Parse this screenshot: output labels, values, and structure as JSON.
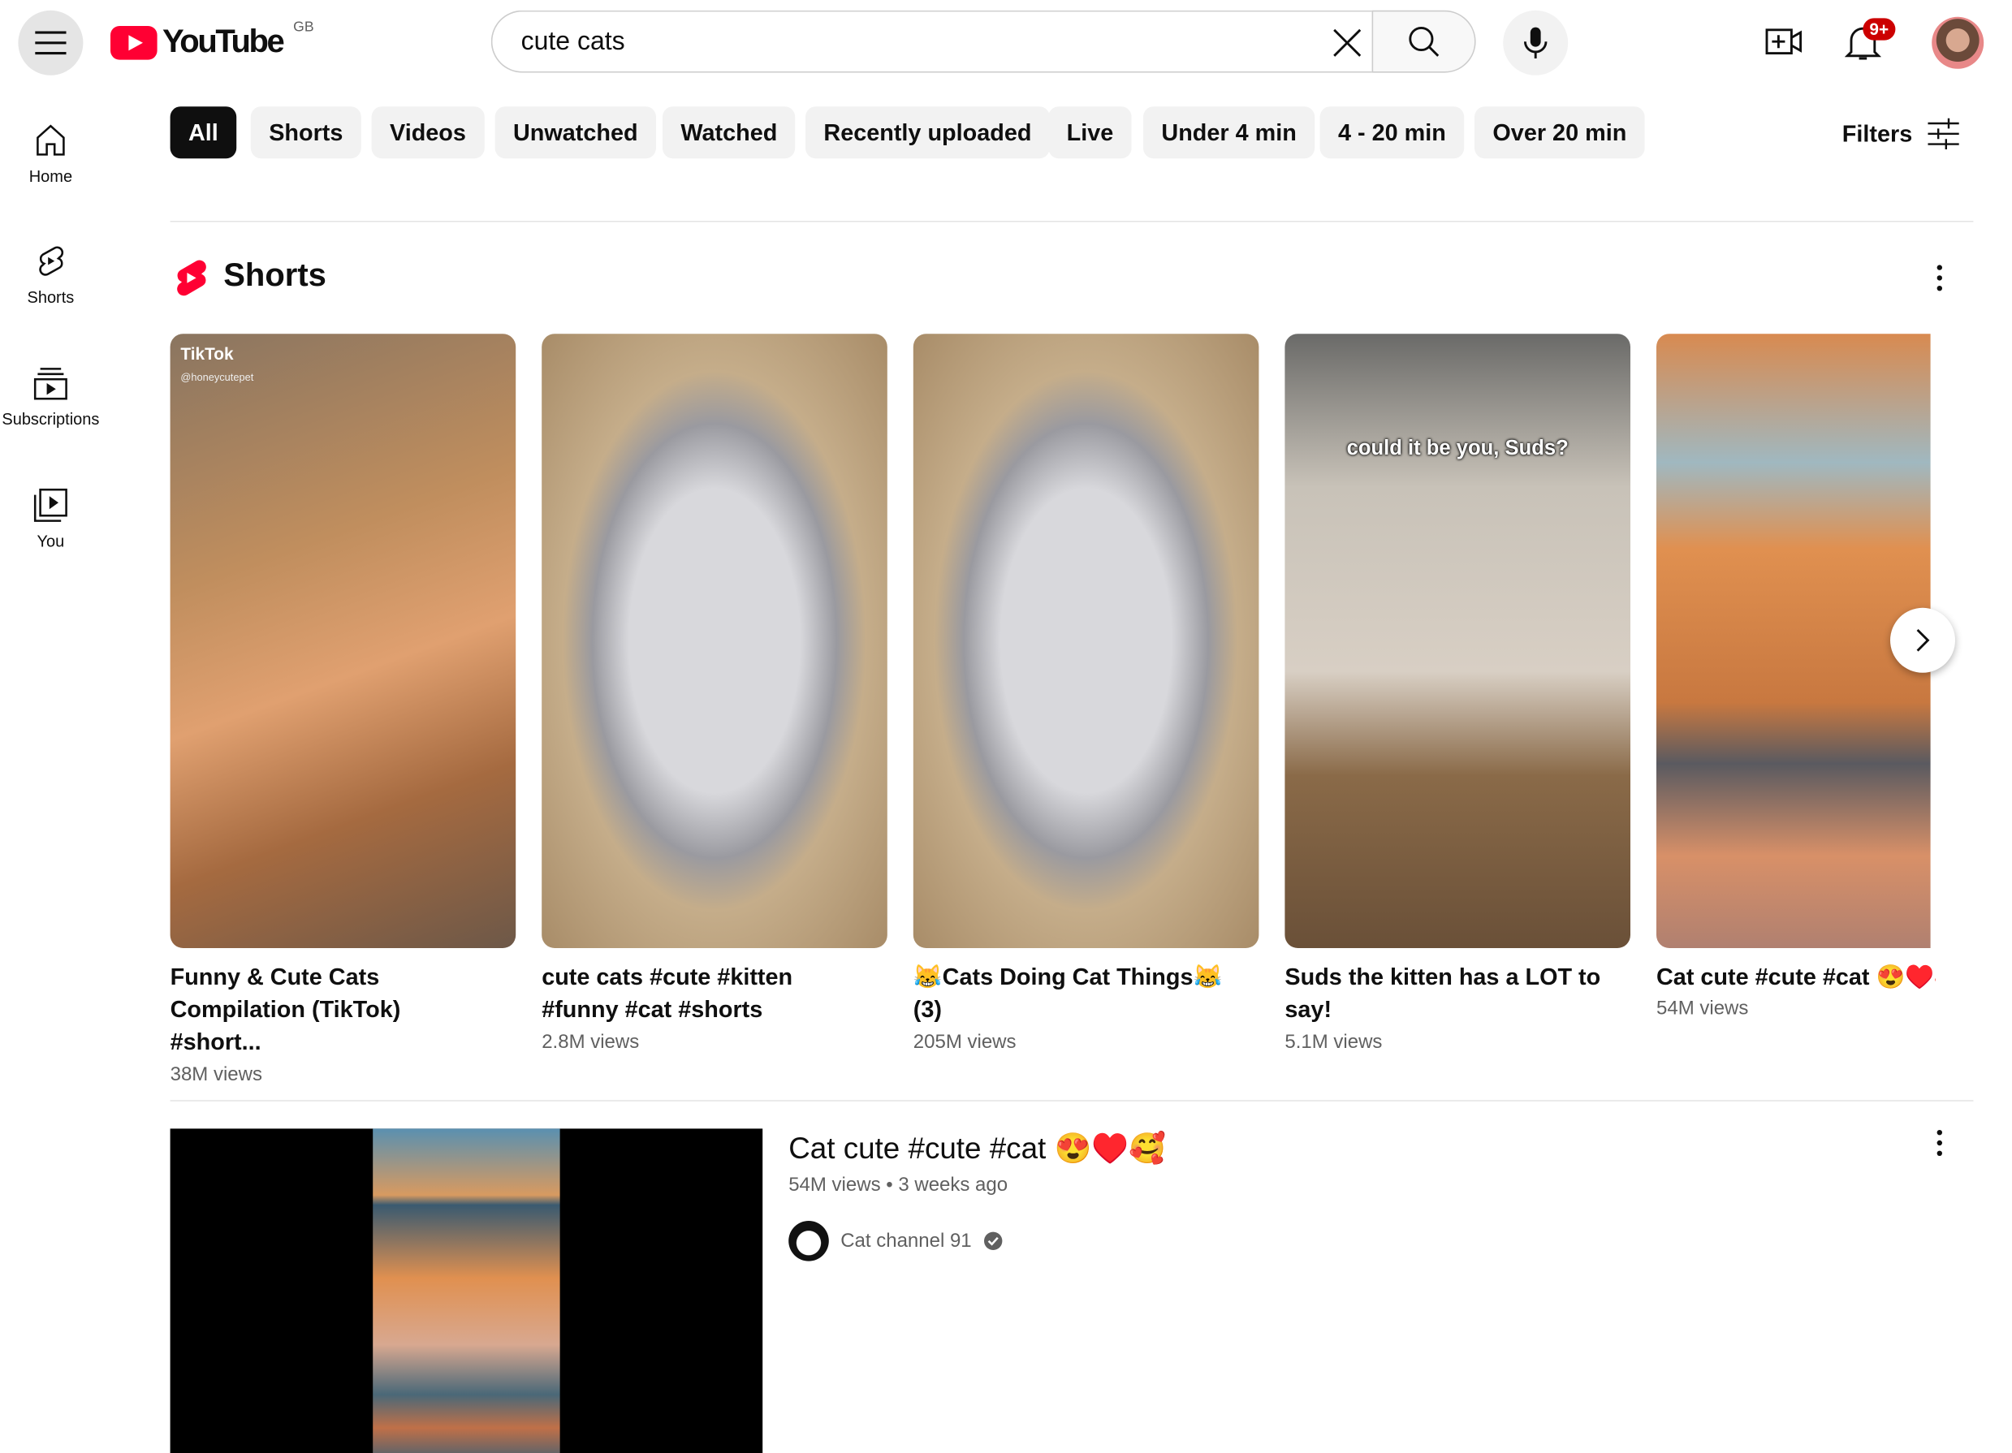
{
  "header": {
    "logo_text": "YouTube",
    "region": "GB",
    "search_value": "cute cats",
    "notification_badge": "9+"
  },
  "chips": [
    "All",
    "Shorts",
    "Videos",
    "Unwatched",
    "Watched",
    "Recently uploaded",
    "Live",
    "Under 4 min",
    "4 - 20 min",
    "Over 20 min"
  ],
  "filters_label": "Filters",
  "sidebar": [
    {
      "label": "Home",
      "icon": "home-icon"
    },
    {
      "label": "Shorts",
      "icon": "shorts-icon"
    },
    {
      "label": "Subscriptions",
      "icon": "subscriptions-icon"
    },
    {
      "label": "You",
      "icon": "you-icon"
    }
  ],
  "shorts_section": {
    "title": "Shorts",
    "items": [
      {
        "title": "Funny & Cute Cats Compilation (TikTok) #short...",
        "views": "38M views",
        "overlay": "TikTok",
        "overlay_handle": "@honeycutepet"
      },
      {
        "title": "cute cats #cute #kitten #funny #cat #shorts",
        "views": "2.8M views"
      },
      {
        "title": "😹Cats Doing Cat Things😹 (3)",
        "views": "205M views"
      },
      {
        "title": "Suds the kitten has a LOT to say!",
        "views": "5.1M views",
        "overlay": "could it be you, Suds?"
      },
      {
        "title": "Cat cute #cute #cat 😍♥️🥰",
        "views": "54M views"
      }
    ]
  },
  "video": {
    "title": "Cat cute #cute #cat 😍♥️🥰",
    "views": "54M views",
    "age": "3 weeks ago",
    "separator": "•",
    "channel": "Cat channel 91",
    "verified": true
  },
  "colors": {
    "brand": "#ff0033",
    "active_chip": "#0f0f0f",
    "chip_bg": "#f2f2f2"
  }
}
